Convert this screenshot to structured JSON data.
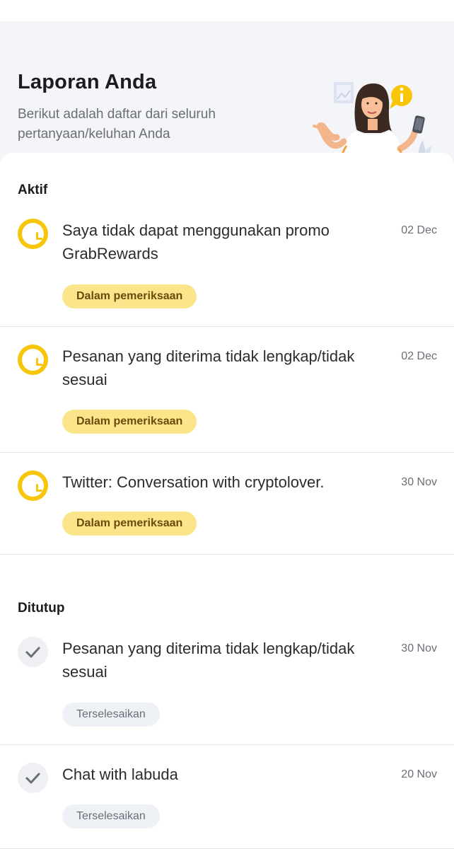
{
  "header": {
    "title": "Laporan Anda",
    "subtitle": "Berikut adalah daftar dari seluruh pertanyaan/keluhan Anda",
    "illustration_icon": "woman-with-phone-illustration"
  },
  "sections": {
    "active": {
      "title": "Aktif",
      "items": [
        {
          "title": "Saya tidak dapat menggunakan promo GrabRewards",
          "date": "02 Dec",
          "status": "Dalam pemeriksaan"
        },
        {
          "title": "Pesanan yang diterima tidak lengkap/tidak sesuai",
          "date": "02 Dec",
          "status": "Dalam pemeriksaan"
        },
        {
          "title": "Twitter: Conversation with cryptolover.",
          "date": "30 Nov",
          "status": "Dalam pemeriksaan"
        }
      ]
    },
    "closed": {
      "title": "Ditutup",
      "items": [
        {
          "title": "Pesanan yang diterima tidak lengkap/tidak sesuai",
          "date": "30 Nov",
          "status": "Terselesaikan"
        },
        {
          "title": "Chat with labuda",
          "date": "20 Nov",
          "status": "Terselesaikan"
        }
      ]
    }
  },
  "colors": {
    "header_bg": "#f4f5f9",
    "active_icon": "#f7c60b",
    "active_badge_bg": "#fbe58a",
    "active_badge_text": "#6b4a0b",
    "closed_badge_bg": "#eef1f6"
  }
}
